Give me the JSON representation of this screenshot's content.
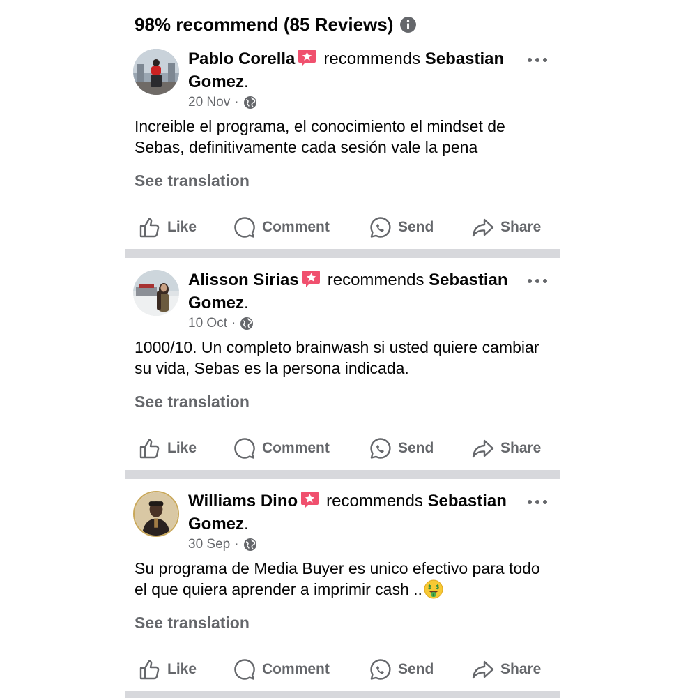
{
  "summary": {
    "text": "98% recommend (85 Reviews)",
    "info_icon": "info-circle-icon"
  },
  "reviews": [
    {
      "author": "Pablo Corella",
      "verb": "recommends",
      "target": "Sebastian Gomez",
      "period": ".",
      "date": "20 Nov",
      "separator": "·",
      "text": "Increible el programa, el conocimiento el mindset de Sebas, definitivamente cada sesión vale la pena",
      "see_translation": "See translation"
    },
    {
      "author": "Alisson Sirias",
      "verb": "recommends",
      "target": "Sebastian Gomez",
      "period": ".",
      "date": "10 Oct",
      "separator": "·",
      "text": "1000/10. Un completo brainwash si usted quiere cambiar su vida, Sebas es la persona indicada.",
      "see_translation": "See translation"
    },
    {
      "author": "Williams Dino",
      "verb": "recommends",
      "target": "Sebastian Gomez",
      "period": ".",
      "date": "30 Sep",
      "separator": "·",
      "text": "Su programa de Media Buyer es unico efectivo para todo el que quiera aprender a imprimir cash ..",
      "see_translation": "See translation"
    }
  ],
  "actions": {
    "like": "Like",
    "comment": "Comment",
    "send": "Send",
    "share": "Share"
  },
  "icons": {
    "recommend_badge": "recommend-star-icon",
    "privacy": "globe-icon",
    "more": "more-dots-icon",
    "like": "thumbs-up-icon",
    "comment": "comment-bubble-icon",
    "send": "messenger-send-icon",
    "share": "share-arrow-icon",
    "emoji": "money-mouth-face-emoji"
  },
  "colors": {
    "text_primary": "#050505",
    "text_secondary": "#65676b",
    "recommend_badge": "#f0506e",
    "divider": "#d7d8dc"
  }
}
